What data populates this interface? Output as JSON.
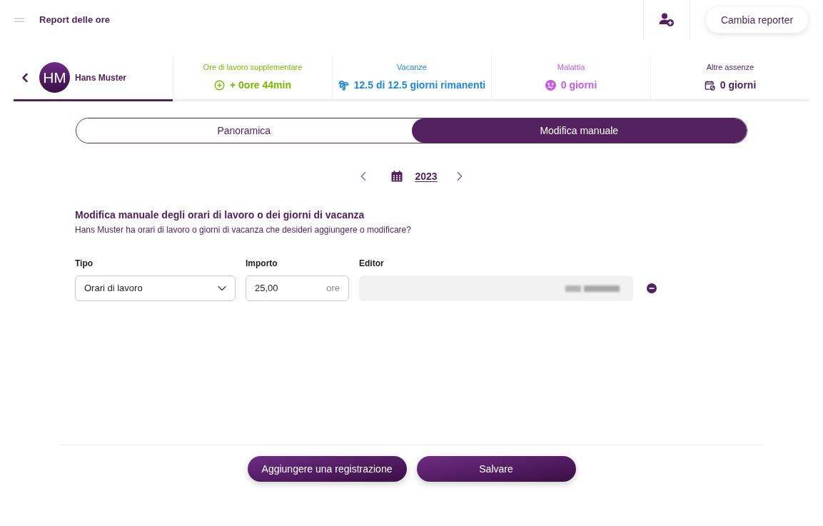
{
  "header": {
    "title": "Report delle ore",
    "button": "Cambia reporter"
  },
  "person": {
    "initials": "HM",
    "name": "Hans Muster",
    "selected": true
  },
  "stats": [
    {
      "kind": "overtime",
      "label": "Ore di lavoro supplementare",
      "value": "+ 0ore 44min",
      "color": "#76b900"
    },
    {
      "kind": "vacation",
      "label": "Vacanze",
      "value": "12.5 di 12.5 giorni rimanenti",
      "color": "#1e88d8"
    },
    {
      "kind": "sickness",
      "label": "Malattia",
      "value": "0 giorni",
      "color": "#c45ae6"
    },
    {
      "kind": "other",
      "label": "Altre assenze",
      "value": "0 giorni",
      "color": "#4a1f5c"
    }
  ],
  "view_tabs": [
    {
      "label": "Panoramica",
      "selected": false
    },
    {
      "label": "Modifica manuale",
      "selected": true
    }
  ],
  "year": "2023",
  "section": {
    "title": "Modifica manuale degli orari di lavoro o dei giorni di vacanza",
    "subtitle": "Hans Muster ha orari di lavoro o giorni di vacanza che desideri aggiungere o modificare?"
  },
  "form": {
    "fields": [
      {
        "kind": "select",
        "label": "Tipo",
        "value": "Orari di lavoro"
      },
      {
        "kind": "amount",
        "label": "Importo",
        "value": "25,00",
        "unit": "ore"
      },
      {
        "kind": "readonly",
        "label": "Editor"
      }
    ]
  },
  "actions": [
    "Aggiungere una registrazione",
    "Salvare"
  ]
}
